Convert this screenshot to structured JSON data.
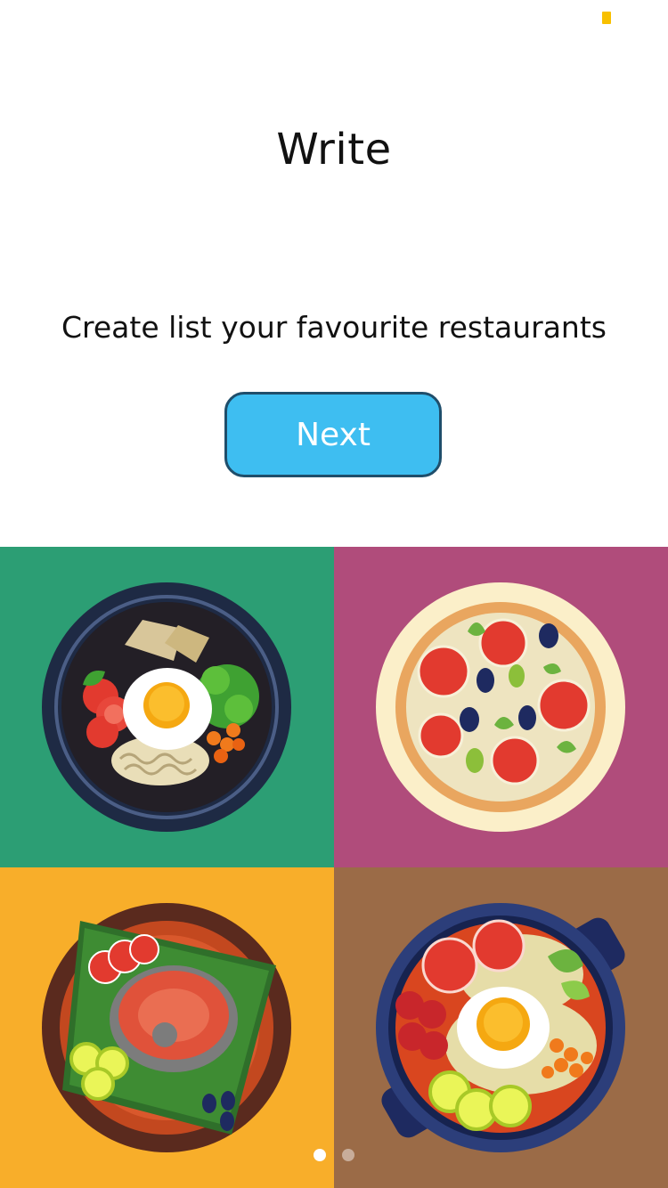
{
  "screen": {
    "title": "Write",
    "subtitle": "Create list your favourite restaurants",
    "next_label": "Next"
  },
  "tiles": [
    {
      "name": "bibimbap-bowl",
      "background": "#2C9E74"
    },
    {
      "name": "pizza",
      "background": "#B04C7B"
    },
    {
      "name": "salmon-plate",
      "background": "#F8AE2A"
    },
    {
      "name": "noodle-pot",
      "background": "#9B6B47"
    }
  ],
  "pager": {
    "pages": 2,
    "current": 1
  },
  "colors": {
    "accent": "#3EBEF1",
    "status": "#F8C000"
  }
}
